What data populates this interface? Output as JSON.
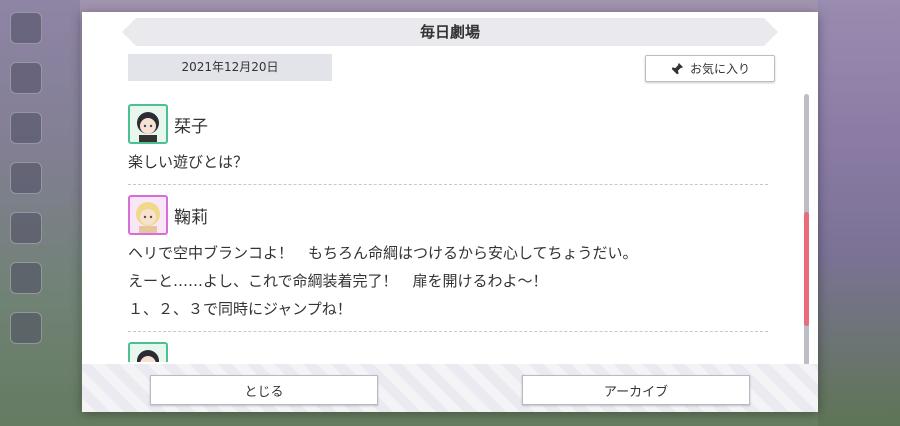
{
  "dialog": {
    "title": "毎日劇場",
    "date": "2021年12月20日",
    "favorite_label": "お気に入り",
    "favorite_icon": "pin-icon"
  },
  "entries": [
    {
      "speaker": "栞子",
      "avatar_color": "#4cc090",
      "lines": [
        "楽しい遊びとは？"
      ]
    },
    {
      "speaker": "鞠莉",
      "avatar_color": "#d76ed7",
      "lines": [
        "ヘリで空中ブランコよ！　もちろん命綱はつけるから安心してちょうだい。",
        "えーと……よし、これで命綱装着完了！　扉を開けるわよ～！",
        "１、２、３で同時にジャンプね！"
      ]
    }
  ],
  "buttons": {
    "close_label": "とじる",
    "archive_label": "アーカイブ"
  }
}
